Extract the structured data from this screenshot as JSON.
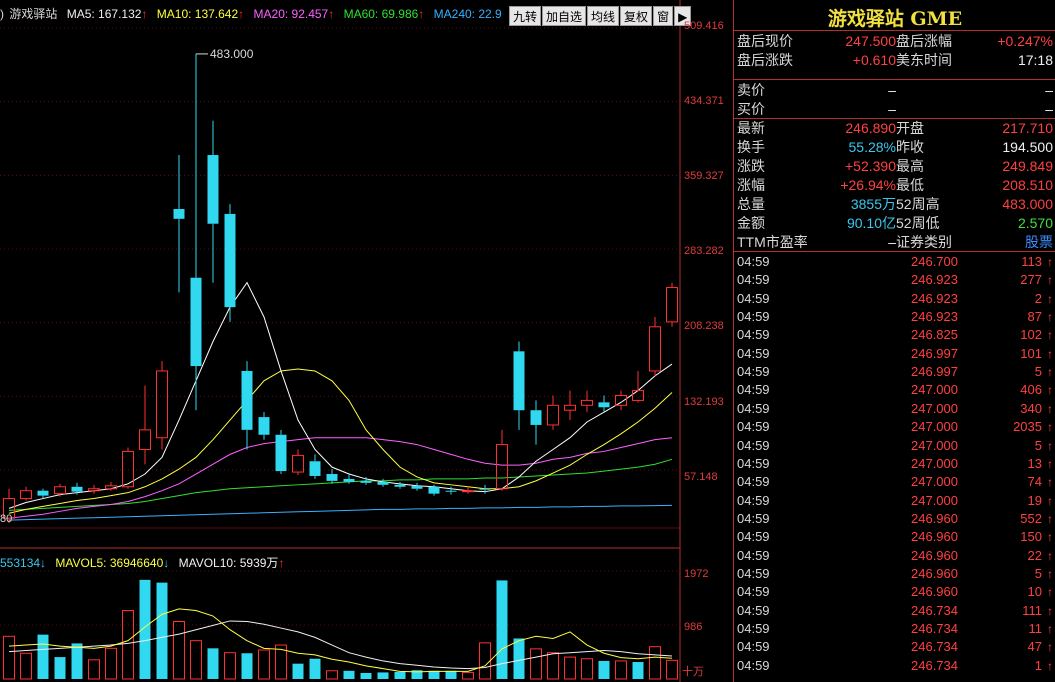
{
  "legend": {
    "prefix": ")",
    "name": "游戏驿站",
    "ma5": "MA5: 167.132",
    "ma10": "MA10: 137.642",
    "ma20": "MA20: 92.457",
    "ma60": "MA60: 69.986",
    "ma240": "MA240: 22.9",
    "up_arrow": "↑"
  },
  "toolbar": [
    "九转",
    "加自选",
    "均线",
    "复权",
    "窗"
  ],
  "toolbar_more": "▶",
  "price_axis": [
    "509.416",
    "434.371",
    "359.327",
    "283.282",
    "208.238",
    "132.193",
    "57.148"
  ],
  "peak_label": "483.000",
  "low_label": "80",
  "volume_legend": {
    "vol": "553134",
    "down_arrow": "↓",
    "mavol5": "MAVOL5: 36946640",
    "mavol10": "MAVOL10: 5939万"
  },
  "volume_axis": [
    "1972",
    "986",
    "十万"
  ],
  "colors": {
    "up": "#ff3030",
    "down": "#30d8f0",
    "ma5": "#ffffff",
    "ma10": "#ffff40",
    "ma20": "#ff60ff",
    "ma60": "#30e030",
    "ma240": "#38b0ff"
  },
  "chart_data": {
    "type": "candlestick",
    "price_ylim": [
      0,
      509.416
    ],
    "volume_ylim": [
      0,
      1972
    ],
    "candles": [
      {
        "o": 10,
        "c": 30,
        "h": 40,
        "l": 5
      },
      {
        "o": 30,
        "c": 38,
        "h": 42,
        "l": 28
      },
      {
        "o": 38,
        "c": 33,
        "h": 40,
        "l": 30
      },
      {
        "o": 35,
        "c": 42,
        "h": 45,
        "l": 32
      },
      {
        "o": 42,
        "c": 37,
        "h": 46,
        "l": 34
      },
      {
        "o": 38,
        "c": 40,
        "h": 44,
        "l": 35
      },
      {
        "o": 40,
        "c": 43,
        "h": 47,
        "l": 38
      },
      {
        "o": 42,
        "c": 78,
        "h": 82,
        "l": 40
      },
      {
        "o": 80,
        "c": 100,
        "h": 145,
        "l": 65
      },
      {
        "o": 92,
        "c": 160,
        "h": 170,
        "l": 80
      },
      {
        "o": 325,
        "c": 315,
        "h": 380,
        "l": 240
      },
      {
        "o": 255,
        "c": 165,
        "h": 483,
        "l": 120
      },
      {
        "o": 380,
        "c": 310,
        "h": 415,
        "l": 250
      },
      {
        "o": 320,
        "c": 225,
        "h": 330,
        "l": 210
      },
      {
        "o": 160,
        "c": 100,
        "h": 170,
        "l": 80
      },
      {
        "o": 113,
        "c": 95,
        "h": 118,
        "l": 90
      },
      {
        "o": 95,
        "c": 58,
        "h": 100,
        "l": 55
      },
      {
        "o": 57,
        "c": 74,
        "h": 80,
        "l": 54
      },
      {
        "o": 68,
        "c": 53,
        "h": 75,
        "l": 50
      },
      {
        "o": 55,
        "c": 48,
        "h": 60,
        "l": 45
      },
      {
        "o": 50,
        "c": 47,
        "h": 56,
        "l": 45
      },
      {
        "o": 48,
        "c": 46,
        "h": 52,
        "l": 44
      },
      {
        "o": 47,
        "c": 44,
        "h": 50,
        "l": 42
      },
      {
        "o": 44,
        "c": 42,
        "h": 47,
        "l": 40
      },
      {
        "o": 43,
        "c": 40,
        "h": 46,
        "l": 38
      },
      {
        "o": 42,
        "c": 35,
        "h": 44,
        "l": 33
      },
      {
        "o": 38,
        "c": 37,
        "h": 42,
        "l": 34
      },
      {
        "o": 38,
        "c": 38,
        "h": 42,
        "l": 35
      },
      {
        "o": 40,
        "c": 39,
        "h": 44,
        "l": 35
      },
      {
        "o": 40,
        "c": 85,
        "h": 100,
        "l": 38
      },
      {
        "o": 180,
        "c": 120,
        "h": 190,
        "l": 100
      },
      {
        "o": 120,
        "c": 105,
        "h": 130,
        "l": 85
      },
      {
        "o": 105,
        "c": 125,
        "h": 135,
        "l": 100
      },
      {
        "o": 120,
        "c": 125,
        "h": 140,
        "l": 110
      },
      {
        "o": 125,
        "c": 130,
        "h": 140,
        "l": 118
      },
      {
        "o": 128,
        "c": 123,
        "h": 135,
        "l": 118
      },
      {
        "o": 125,
        "c": 135,
        "h": 140,
        "l": 120
      },
      {
        "o": 130,
        "c": 140,
        "h": 160,
        "l": 128
      },
      {
        "o": 160,
        "c": 205,
        "h": 215,
        "l": 155
      },
      {
        "o": 210,
        "c": 245,
        "h": 250,
        "l": 205
      }
    ],
    "volumes": [
      {
        "v": 780,
        "up": true
      },
      {
        "v": 470,
        "up": true
      },
      {
        "v": 810,
        "up": false
      },
      {
        "v": 400,
        "up": false
      },
      {
        "v": 650,
        "up": false
      },
      {
        "v": 350,
        "up": true
      },
      {
        "v": 560,
        "up": true
      },
      {
        "v": 1250,
        "up": true
      },
      {
        "v": 1810,
        "up": false
      },
      {
        "v": 1760,
        "up": false
      },
      {
        "v": 1050,
        "up": true
      },
      {
        "v": 700,
        "up": true
      },
      {
        "v": 560,
        "up": false
      },
      {
        "v": 480,
        "up": true
      },
      {
        "v": 470,
        "up": false
      },
      {
        "v": 530,
        "up": true
      },
      {
        "v": 620,
        "up": true
      },
      {
        "v": 280,
        "up": false
      },
      {
        "v": 370,
        "up": false
      },
      {
        "v": 150,
        "up": true
      },
      {
        "v": 150,
        "up": false
      },
      {
        "v": 110,
        "up": false
      },
      {
        "v": 120,
        "up": false
      },
      {
        "v": 130,
        "up": false
      },
      {
        "v": 160,
        "up": false
      },
      {
        "v": 150,
        "up": false
      },
      {
        "v": 150,
        "up": false
      },
      {
        "v": 120,
        "up": true
      },
      {
        "v": 660,
        "up": true
      },
      {
        "v": 1800,
        "up": false
      },
      {
        "v": 740,
        "up": false
      },
      {
        "v": 550,
        "up": true
      },
      {
        "v": 480,
        "up": true
      },
      {
        "v": 400,
        "up": true
      },
      {
        "v": 370,
        "up": true
      },
      {
        "v": 330,
        "up": false
      },
      {
        "v": 330,
        "up": true
      },
      {
        "v": 310,
        "up": false
      },
      {
        "v": 590,
        "up": true
      },
      {
        "v": 340,
        "up": true
      }
    ],
    "ma5": [
      20,
      26,
      30,
      34,
      36,
      38,
      40,
      45,
      55,
      72,
      110,
      150,
      190,
      225,
      250,
      215,
      160,
      110,
      80,
      62,
      55,
      50,
      47,
      45,
      43,
      42,
      40,
      38,
      37,
      40,
      52,
      68,
      80,
      92,
      108,
      118,
      128,
      140,
      155,
      167
    ],
    "ma10": [
      15,
      19,
      22,
      25,
      28,
      30,
      33,
      36,
      42,
      50,
      60,
      72,
      90,
      110,
      130,
      150,
      160,
      162,
      160,
      150,
      130,
      100,
      80,
      62,
      52,
      46,
      44,
      42,
      40,
      40,
      42,
      48,
      56,
      64,
      75,
      85,
      96,
      108,
      122,
      138
    ],
    "ma20": [
      10,
      12,
      14,
      17,
      20,
      22,
      24,
      27,
      32,
      38,
      45,
      55,
      65,
      75,
      82,
      86,
      88,
      90,
      92,
      92,
      92,
      92,
      90,
      88,
      85,
      80,
      75,
      70,
      66,
      64,
      64,
      66,
      70,
      72,
      76,
      78,
      82,
      86,
      90,
      92
    ],
    "ma60": [
      18,
      19,
      20,
      21,
      22,
      23,
      24,
      25,
      27,
      30,
      33,
      36,
      38,
      40,
      41,
      42,
      43,
      44,
      45,
      46,
      47,
      48,
      48,
      49,
      49,
      50,
      50,
      50,
      51,
      51,
      52,
      53,
      54,
      55,
      56,
      58,
      60,
      62,
      65,
      70
    ],
    "ma240": [
      8,
      8.5,
      9,
      9.5,
      10,
      10.5,
      11,
      11.5,
      12,
      12.5,
      13,
      13.5,
      14,
      14.5,
      15,
      15.5,
      16,
      16.5,
      17,
      17.5,
      18,
      18.5,
      19,
      19,
      19.5,
      19.5,
      20,
      20,
      20.5,
      20.5,
      21,
      21,
      21.5,
      21.5,
      22,
      22,
      22.5,
      22.5,
      22.8,
      23
    ],
    "mavol5": [
      600,
      620,
      640,
      600,
      580,
      560,
      600,
      700,
      950,
      1180,
      1280,
      1250,
      1150,
      900,
      700,
      560,
      540,
      470,
      440,
      360,
      310,
      240,
      190,
      140,
      130,
      140,
      140,
      140,
      240,
      550,
      700,
      780,
      740,
      860,
      620,
      470,
      390,
      370,
      400,
      380
    ],
    "mavol10": [
      500,
      520,
      540,
      560,
      580,
      600,
      620,
      650,
      700,
      760,
      820,
      900,
      980,
      1060,
      1050,
      1000,
      930,
      860,
      760,
      620,
      480,
      400,
      330,
      280,
      250,
      220,
      200,
      190,
      210,
      280,
      340,
      400,
      460,
      480,
      500,
      520,
      500,
      460,
      440,
      420
    ]
  },
  "panel": {
    "title": "游戏驿站 GME",
    "after_hours": [
      {
        "l1": "盘后现价",
        "v1": "247.500",
        "c1": "red",
        "l2": "盘后涨幅",
        "v2": "+0.247%",
        "c2": "red"
      },
      {
        "l1": "盘后涨跌",
        "v1": "+0.610",
        "c1": "red",
        "l2": "美东时间",
        "v2": "17:18",
        "c2": "white"
      }
    ],
    "bid_ask": [
      {
        "l1": "卖价",
        "v1": "–",
        "c1": "white",
        "l2": "",
        "v2": "–",
        "c2": "white"
      },
      {
        "l1": "买价",
        "v1": "–",
        "c1": "white",
        "l2": "",
        "v2": "–",
        "c2": "white"
      }
    ],
    "quote": [
      {
        "l1": "最新",
        "v1": "246.890",
        "c1": "red",
        "l2": "开盘",
        "v2": "217.710",
        "c2": "red"
      },
      {
        "l1": "换手",
        "v1": "55.28%",
        "c1": "cyan",
        "l2": "昨收",
        "v2": "194.500",
        "c2": "white"
      },
      {
        "l1": "涨跌",
        "v1": "+52.390",
        "c1": "red",
        "l2": "最高",
        "v2": "249.849",
        "c2": "red"
      },
      {
        "l1": "涨幅",
        "v1": "+26.94%",
        "c1": "red",
        "l2": "最低",
        "v2": "208.510",
        "c2": "red"
      },
      {
        "l1": "总量",
        "v1": "3855万",
        "c1": "cyan",
        "l2": "52周高",
        "v2": "483.000",
        "c2": "red"
      },
      {
        "l1": "金额",
        "v1": "90.10亿",
        "c1": "cyan",
        "l2": "52周低",
        "v2": "2.570",
        "c2": "green"
      },
      {
        "l1": "TTM市盈率",
        "v1": "–",
        "c1": "white",
        "l2": "证券类别",
        "v2": "股票",
        "c2": "blue"
      }
    ],
    "ticks": [
      {
        "t": "04:59",
        "p": "246.700",
        "q": "113"
      },
      {
        "t": "04:59",
        "p": "246.923",
        "q": "277"
      },
      {
        "t": "04:59",
        "p": "246.923",
        "q": "2"
      },
      {
        "t": "04:59",
        "p": "246.923",
        "q": "87"
      },
      {
        "t": "04:59",
        "p": "246.825",
        "q": "102"
      },
      {
        "t": "04:59",
        "p": "246.997",
        "q": "101"
      },
      {
        "t": "04:59",
        "p": "246.997",
        "q": "5"
      },
      {
        "t": "04:59",
        "p": "247.000",
        "q": "406"
      },
      {
        "t": "04:59",
        "p": "247.000",
        "q": "340"
      },
      {
        "t": "04:59",
        "p": "247.000",
        "q": "2035"
      },
      {
        "t": "04:59",
        "p": "247.000",
        "q": "5"
      },
      {
        "t": "04:59",
        "p": "247.000",
        "q": "13"
      },
      {
        "t": "04:59",
        "p": "247.000",
        "q": "74"
      },
      {
        "t": "04:59",
        "p": "247.000",
        "q": "19"
      },
      {
        "t": "04:59",
        "p": "246.960",
        "q": "552"
      },
      {
        "t": "04:59",
        "p": "246.960",
        "q": "150"
      },
      {
        "t": "04:59",
        "p": "246.960",
        "q": "22"
      },
      {
        "t": "04:59",
        "p": "246.960",
        "q": "5"
      },
      {
        "t": "04:59",
        "p": "246.960",
        "q": "10"
      },
      {
        "t": "04:59",
        "p": "246.734",
        "q": "111"
      },
      {
        "t": "04:59",
        "p": "246.734",
        "q": "11"
      },
      {
        "t": "04:59",
        "p": "246.734",
        "q": "47"
      },
      {
        "t": "04:59",
        "p": "246.734",
        "q": "1"
      }
    ],
    "tick_arrow": "↑"
  }
}
